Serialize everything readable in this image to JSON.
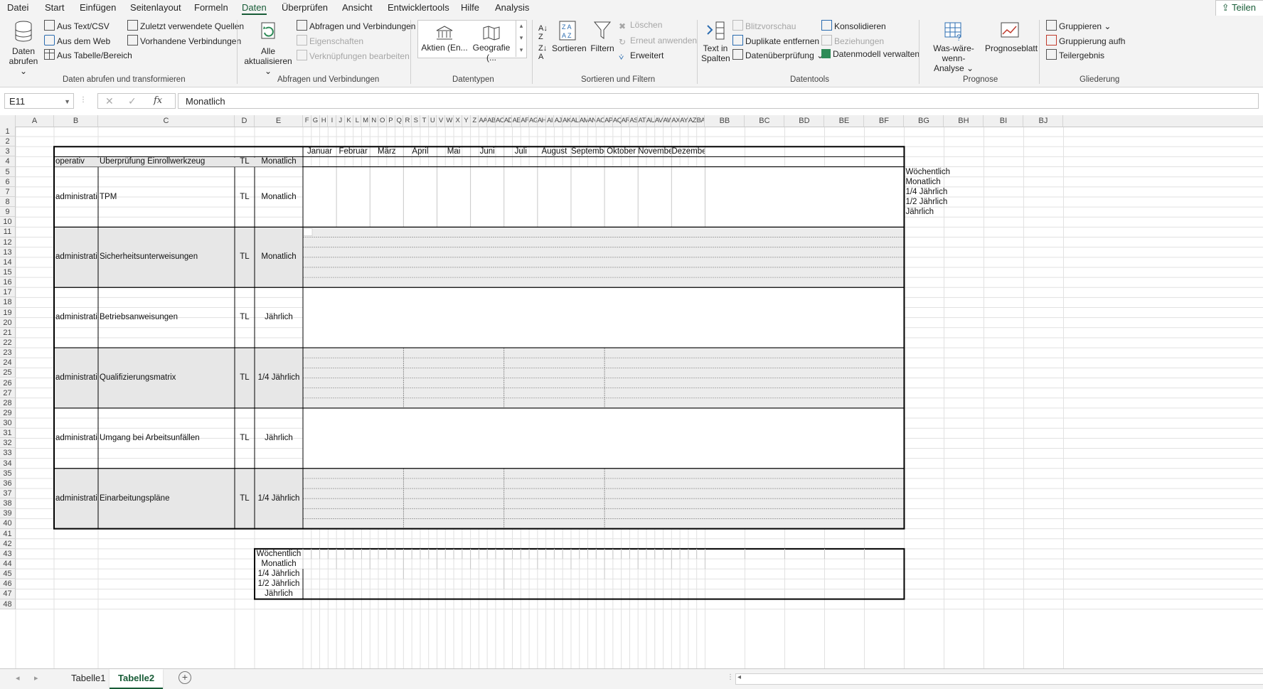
{
  "menu": {
    "items": [
      "Datei",
      "Start",
      "Einfügen",
      "Seitenlayout",
      "Formeln",
      "Daten",
      "Überprüfen",
      "Ansicht",
      "Entwicklertools",
      "Hilfe",
      "Analysis"
    ],
    "active": "Daten",
    "share": "Teilen"
  },
  "ribbon": {
    "get_data": {
      "daten_abrufen_1": "Daten",
      "daten_abrufen_2": "abrufen",
      "text_csv": "Aus Text/CSV",
      "web": "Aus dem Web",
      "table_range": "Aus Tabelle/Bereich",
      "recent_sources": "Zuletzt verwendete Quellen",
      "existing_connections": "Vorhandene Verbindungen",
      "label": "Daten abrufen und transformieren"
    },
    "queries": {
      "refresh_1": "Alle",
      "refresh_2": "aktualisieren",
      "queries_connections": "Abfragen und Verbindungen",
      "properties": "Eigenschaften",
      "edit_links": "Verknüpfungen bearbeiten",
      "label": "Abfragen und Verbindungen"
    },
    "datatypes": {
      "stocks": "Aktien (En...",
      "geography": "Geografie (...",
      "label": "Datentypen"
    },
    "sort_filter": {
      "sort": "Sortieren",
      "filter": "Filtern",
      "clear": "Löschen",
      "reapply": "Erneut anwenden",
      "advanced": "Erweitert",
      "label": "Sortieren und Filtern"
    },
    "datatools": {
      "text_to_columns_1": "Text in",
      "text_to_columns_2": "Spalten",
      "flash_fill": "Blitzvorschau",
      "remove_duplicates": "Duplikate entfernen",
      "validation": "Datenüberprüfung",
      "consolidate": "Konsolidieren",
      "relationships": "Beziehungen",
      "data_model": "Datenmodell verwalten",
      "label": "Datentools"
    },
    "forecast": {
      "whatif_1": "Was-wäre-wenn-",
      "whatif_2": "Analyse",
      "forecast_sheet": "Prognoseblatt",
      "label": "Prognose"
    },
    "outline": {
      "group": "Gruppieren",
      "ungroup": "Gruppierung aufh",
      "subtotal": "Teilergebnis",
      "label": "Gliederung"
    }
  },
  "formula_bar": {
    "name_box": "E11",
    "content": "Monatlich",
    "fx": "fx"
  },
  "columns": [
    "A",
    "B",
    "C",
    "D",
    "E",
    "F",
    "G",
    "H",
    "I",
    "J",
    "K",
    "L",
    "M",
    "N",
    "O",
    "P",
    "Q",
    "R",
    "S",
    "T",
    "U",
    "V",
    "W",
    "X",
    "Y",
    "Z",
    "AA",
    "AB",
    "AC",
    "AD",
    "AE",
    "AF",
    "AG",
    "AH",
    "AI",
    "AJ",
    "AK",
    "AL",
    "AM",
    "AN",
    "AO",
    "AP",
    "AQ",
    "AR",
    "AS",
    "AT",
    "AU",
    "AV",
    "AW",
    "AX",
    "AY",
    "AZ",
    "BA",
    "BB",
    "BC",
    "BD",
    "BE",
    "BF",
    "BG",
    "BH",
    "BI",
    "BJ"
  ],
  "rows": [
    "1",
    "2",
    "3",
    "4",
    "5",
    "6",
    "7",
    "8",
    "9",
    "10",
    "11",
    "12",
    "13",
    "14",
    "15",
    "16",
    "17",
    "18",
    "19",
    "20",
    "21",
    "22",
    "23",
    "24",
    "25",
    "26",
    "27",
    "28",
    "29",
    "30",
    "31",
    "32",
    "33",
    "34",
    "35",
    "36",
    "37",
    "38",
    "39",
    "40",
    "41",
    "42",
    "43",
    "44",
    "45",
    "46",
    "47",
    "48"
  ],
  "months": [
    "Januar",
    "Februar",
    "März",
    "April",
    "Mai",
    "Juni",
    "Juli",
    "August",
    "September",
    "Oktober",
    "November",
    "Dezember"
  ],
  "table_headers": {
    "operativ": "operativ",
    "check": "Überprüfung Einrollwerkzeug",
    "tl": "TL",
    "frequency": "Monatlich"
  },
  "tasks": [
    {
      "type": "administrati",
      "name": "TPM",
      "tl": "TL",
      "freq": "Monatlich"
    },
    {
      "type": "administrati",
      "name": "Sicherheitsunterweisungen",
      "tl": "TL",
      "freq": "Monatlich"
    },
    {
      "type": "administrati",
      "name": "Betriebsanweisungen",
      "tl": "TL",
      "freq": "Jährlich"
    },
    {
      "type": "administrati",
      "name": "Qualifizierungsmatrix",
      "tl": "TL",
      "freq": "1/4 Jährlich"
    },
    {
      "type": "administrati",
      "name": "Umgang bei Arbeitsunfällen",
      "tl": "TL",
      "freq": "Jährlich"
    },
    {
      "type": "administrati",
      "name": "Einarbeitungspläne",
      "tl": "TL",
      "freq": "1/4 Jährlich"
    }
  ],
  "legend": [
    "Wöchentlich",
    "Monatlich",
    "1/4 Jährlich",
    "1/2 Jährlich",
    "Jährlich"
  ],
  "side_list": [
    "Wöchentlich",
    "Monatlich",
    "1/4 Jährlich",
    "1/2 Jährlich",
    "Jährlich"
  ],
  "sheets": {
    "tabs": [
      "Tabelle1",
      "Tabelle2"
    ],
    "active": "Tabelle2"
  }
}
